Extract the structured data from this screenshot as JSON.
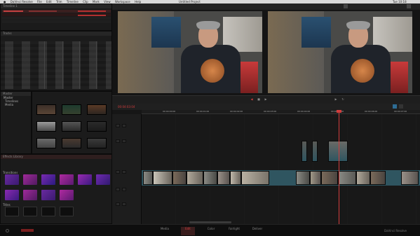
{
  "menubar": {
    "items": [
      "DaVinci Resolve",
      "File",
      "Edit",
      "Trim",
      "Timeline",
      "Clip",
      "Mark",
      "View",
      "Workspace",
      "Help"
    ],
    "title": "Untitled Project",
    "clock": "Tue 10:18"
  },
  "project": {
    "name": "Untitled Project",
    "edit_list_header": "Timeline 1",
    "tracks_header": "Tracks"
  },
  "media": {
    "header": "Master",
    "bins": [
      "Master",
      "Timelines",
      "Media"
    ],
    "effects_header": "Effects Library",
    "effects_groups": [
      "Transitions",
      "Titles"
    ]
  },
  "timeline": {
    "timecode": "00:04:03:04",
    "ruler": [
      "00:04:00:00",
      "00:04:01:00",
      "00:04:02:00",
      "00:04:03:00",
      "00:04:04:00",
      "00:04:05:00",
      "00:04:06:00",
      "00:04:07:00"
    ]
  },
  "bottom_tabs": [
    "Media",
    "Edit",
    "Color",
    "Fairlight",
    "Deliver"
  ],
  "branding": "DaVinci Resolve",
  "colors": {
    "accent_red": "#c0392b",
    "timeline_teal": "#2f5560",
    "playhead": "#d23c3c"
  }
}
